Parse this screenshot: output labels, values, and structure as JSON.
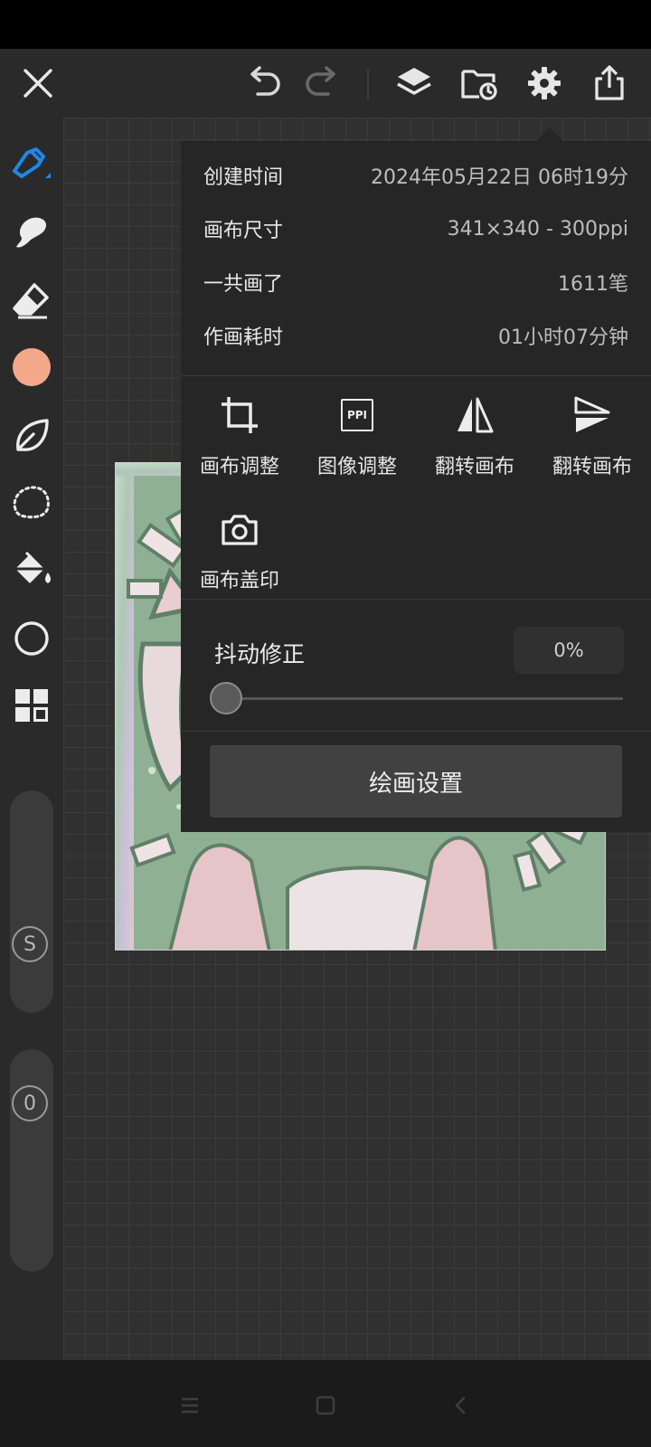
{
  "top_bar": {
    "icons": [
      "close-icon",
      "undo-icon",
      "redo-icon",
      "layers-icon",
      "folder-sync-icon",
      "gear-icon",
      "share-icon"
    ]
  },
  "sidebar": {
    "tools": [
      "pen-tool-icon",
      "smudge-icon",
      "eraser-icon",
      "color-swatch",
      "leaf-brush-icon",
      "lasso-icon",
      "fill-bucket-icon",
      "shape-circle-icon",
      "grid-icon"
    ],
    "current_color": "#f4a88a",
    "size_slider_label": "S",
    "opacity_slider_label": "0"
  },
  "info_panel": {
    "rows": [
      {
        "key": "创建时间",
        "value": "2024年05月22日 06时19分"
      },
      {
        "key": "画布尺寸",
        "value": "341×340 - 300ppi"
      },
      {
        "key": "一共画了",
        "value": "1611笔"
      },
      {
        "key": "作画耗时",
        "value": "01小时07分钟"
      }
    ],
    "actions": [
      {
        "label": "画布调整",
        "icon": "crop-icon"
      },
      {
        "label": "图像调整",
        "icon": "ppi-icon"
      },
      {
        "label": "翻转画布",
        "icon": "flip-horizontal-icon"
      },
      {
        "label": "翻转画布",
        "icon": "flip-vertical-icon"
      },
      {
        "label": "画布盖印",
        "icon": "camera-icon"
      }
    ],
    "ppi_icon_text": "PPI",
    "stabilization": {
      "label": "抖动修正",
      "value": "0%",
      "level": 0
    },
    "paint_settings_label": "绘画设置"
  },
  "nav_bar": {
    "icons": [
      "menu-icon",
      "home-icon",
      "back-icon"
    ]
  },
  "colors": {
    "accent": "#1e88e5",
    "panel_bg": "#262626",
    "button_bg": "#414141"
  }
}
